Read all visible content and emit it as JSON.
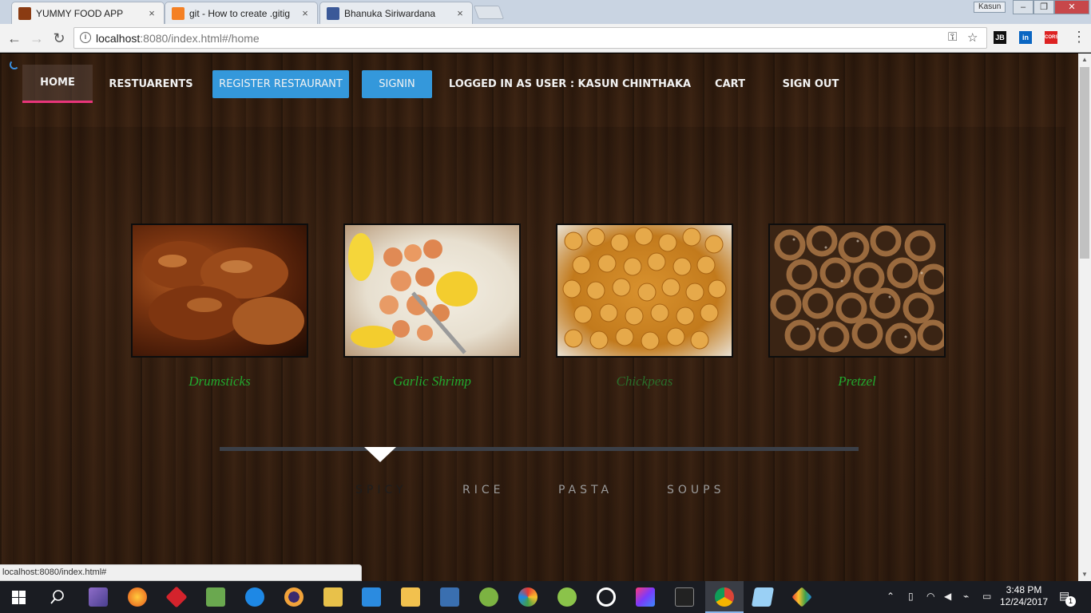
{
  "browser": {
    "tabs": [
      {
        "title": "YUMMY FOOD APP",
        "active": true,
        "favicon_color": "#8a3b12"
      },
      {
        "title": "git - How to create .gitig",
        "active": false,
        "favicon_color": "#f48024"
      },
      {
        "title": "Bhanuka Siriwardana",
        "active": false,
        "favicon_color": "#3b5998"
      }
    ],
    "close_glyph": "×",
    "window_user": "Kasun",
    "address": {
      "host": "localhost",
      "path": ":8080/index.html#/home"
    },
    "extensions": [
      "JB",
      "in",
      "CORS"
    ]
  },
  "app": {
    "nav": {
      "home": "HOME",
      "restaurants": "RESTUARENTS",
      "register": "REGISTER RESTAURANT",
      "signin": "SIGNIN",
      "logged_in": "LOGGED IN AS USER : KASUN CHINTHAKA",
      "cart": "CART",
      "signout": "SIGN OUT"
    },
    "foods": [
      {
        "name": "Drumsticks",
        "icon": "roast-chicken-photo"
      },
      {
        "name": "Garlic Shrimp",
        "icon": "shrimp-plate-photo"
      },
      {
        "name": "Chickpeas",
        "icon": "chickpeas-photo"
      },
      {
        "name": "Pretzel",
        "icon": "pretzels-photo"
      }
    ],
    "categories": [
      "SPICY",
      "RICE",
      "PASTA",
      "SOUPS"
    ],
    "active_category": "SPICY"
  },
  "status_bar": {
    "url": "localhost:8080/index.html#"
  },
  "taskbar": {
    "time": "3:48 PM",
    "date": "12/24/2017",
    "notifications": "1"
  }
}
